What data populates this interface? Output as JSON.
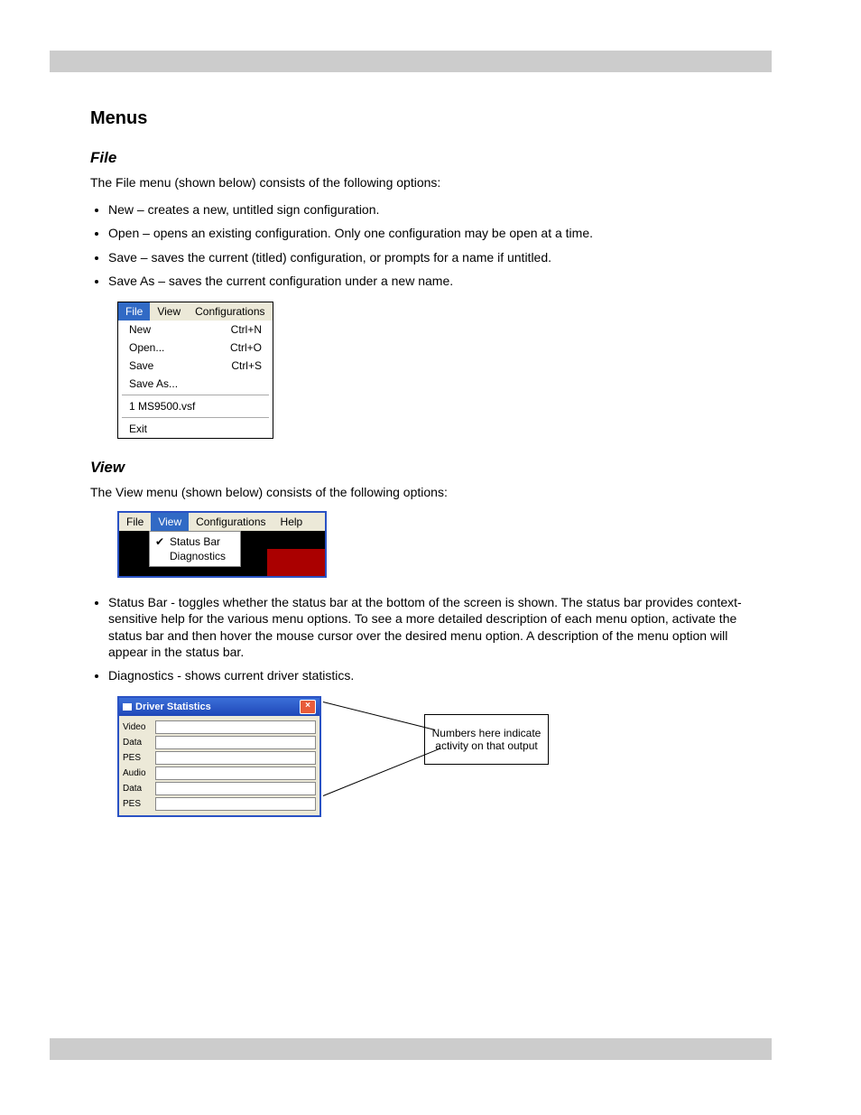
{
  "section_title": "Menus",
  "sub_file": "File",
  "file_para": "The File menu (shown below) consists of the following options:",
  "file_bullets": [
    "New – creates a new, untitled sign configuration.",
    "Open – opens an existing configuration. Only one configuration may be open at a time.",
    "Save – saves the current (titled) configuration, or prompts for a name if untitled.",
    "Save As – saves the current configuration under a new name."
  ],
  "file_menu": {
    "bar": [
      "File",
      "View",
      "Configurations"
    ],
    "items": [
      {
        "label": "New",
        "accel": "Ctrl+N"
      },
      {
        "label": "Open...",
        "accel": "Ctrl+O"
      },
      {
        "label": "Save",
        "accel": "Ctrl+S"
      },
      {
        "label": "Save As...",
        "accel": ""
      }
    ],
    "recent": "1 MS9500.vsf",
    "exit": "Exit"
  },
  "sub_view": "View",
  "view_para": "The View menu (shown below) consists of the following options:",
  "view_menu": {
    "bar": [
      "File",
      "View",
      "Configurations",
      "Help"
    ],
    "items": [
      "Status Bar",
      "Diagnostics"
    ]
  },
  "view_bullets": [
    "Status Bar - toggles whether the status bar at the bottom of the screen is shown. The status bar provides context-sensitive help for the various menu options. To see a more detailed description of each menu option, activate the status bar and then hover the mouse cursor over the desired menu option. A description of the menu option will appear in the status bar.",
    "Diagnostics - shows current driver statistics."
  ],
  "driver_stats": {
    "title": "Driver Statistics",
    "rows": [
      "Video",
      "Data",
      "PES",
      "Audio",
      "Data",
      "PES"
    ]
  },
  "note_box": "Numbers here indicate activity on that output"
}
